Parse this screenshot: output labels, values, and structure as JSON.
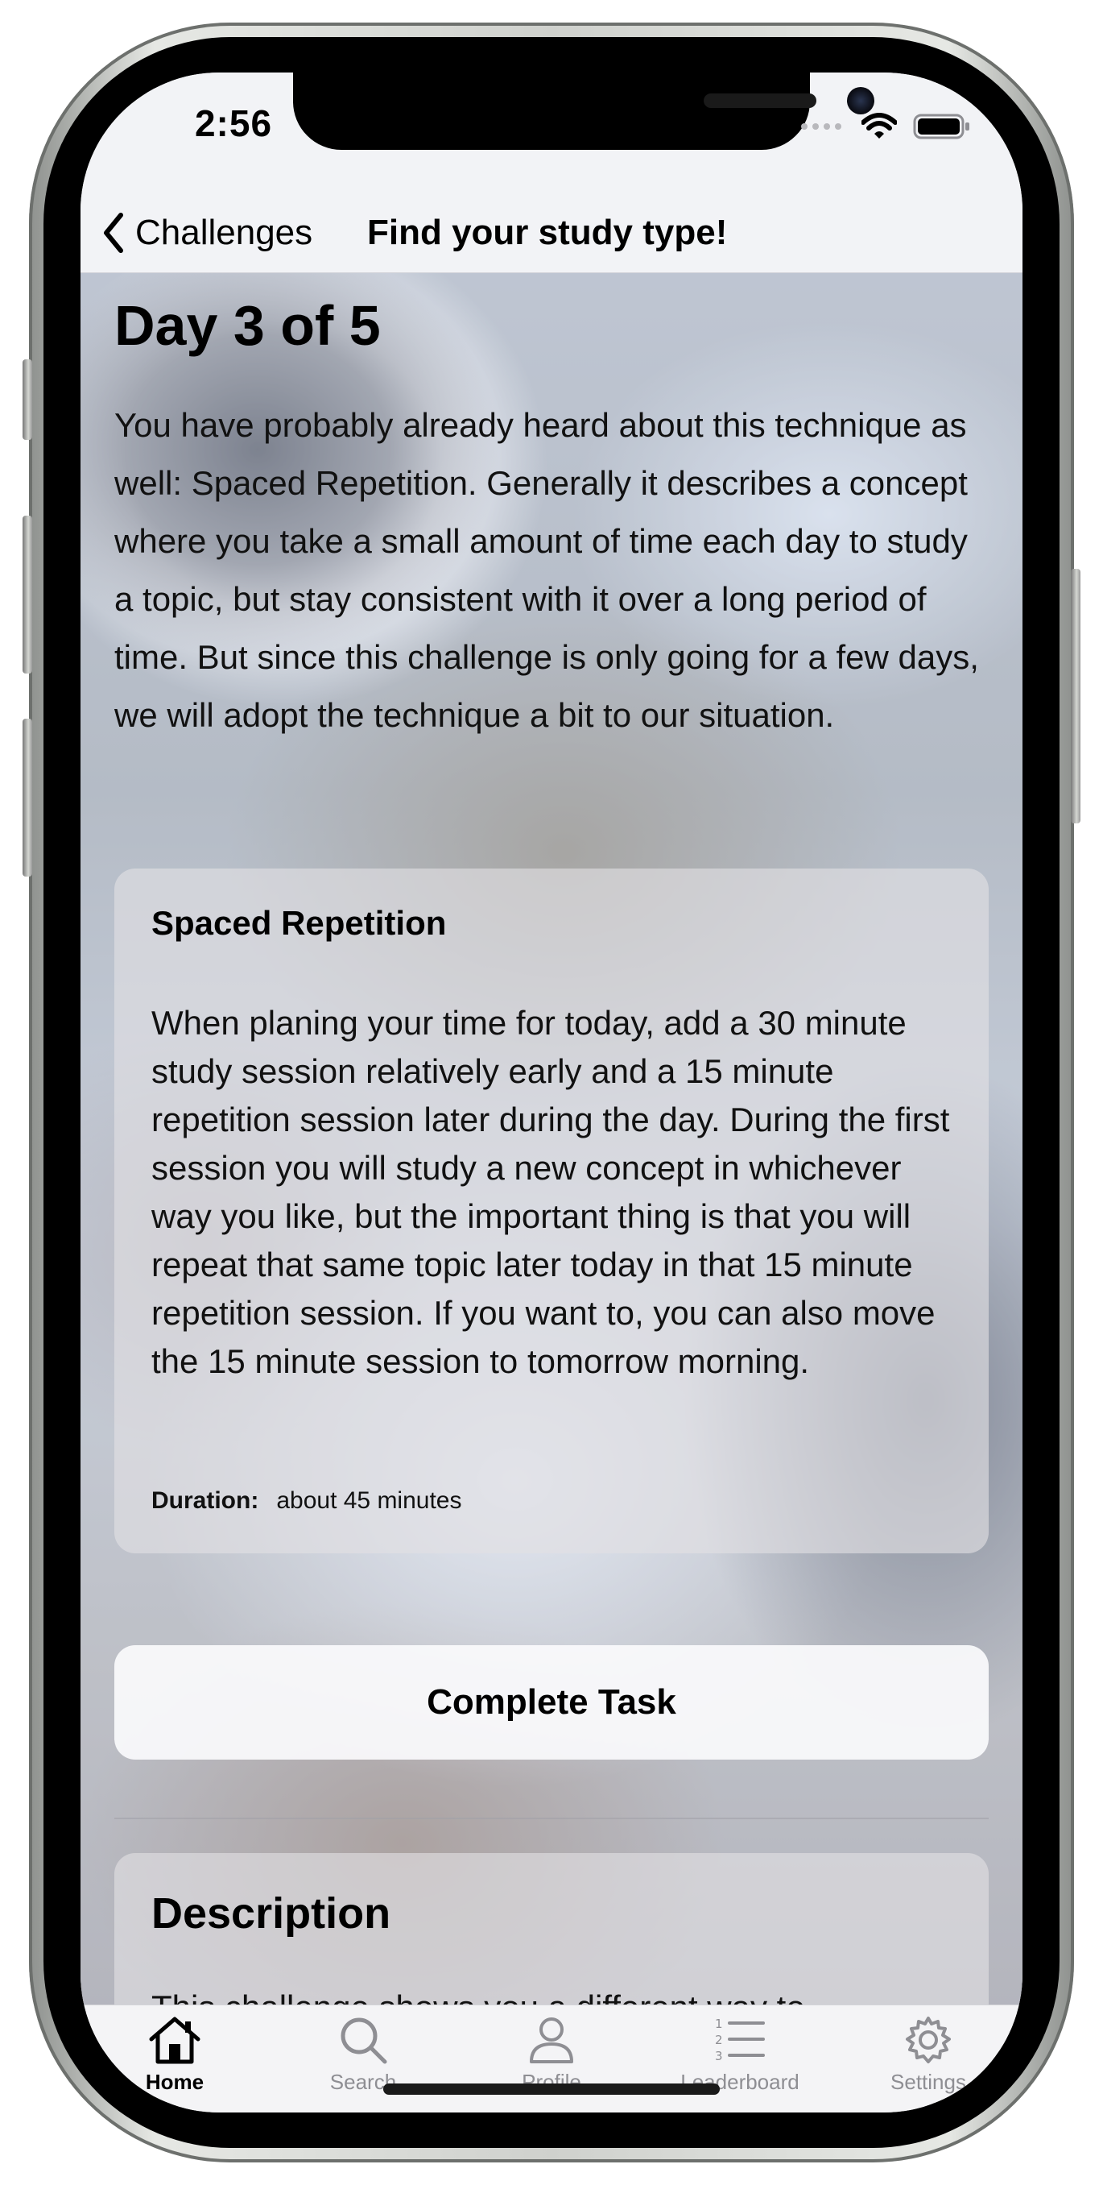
{
  "status_bar": {
    "time": "2:56"
  },
  "nav": {
    "back_label": "Challenges",
    "title": "Find your study type!"
  },
  "content": {
    "day_title": "Day 3 of 5",
    "intro": "You have probably already heard about this technique as well: Spaced Repetition. Generally it describes a concept where you take a small amount of time each day to study a topic, but stay consistent with it over a long period of time. But since this challenge is only going for a few days, we will adopt the technique a bit to our situation.",
    "task": {
      "title": "Spaced Repetition",
      "body": "When planing your time for today, add a 30 minute study session relatively early and a 15 minute repetition session later during the day. During the first session you will study a new concept in whichever way you like, but the important thing is that you will repeat that same topic later today in that 15 minute repetition session. If you want to, you can also move the 15 minute session to tomorrow morning.",
      "duration_label": "Duration:",
      "duration_value": "about 45 minutes"
    },
    "complete_button": "Complete Task",
    "description": {
      "title": "Description",
      "body": "This challenge shows you a different way to"
    }
  },
  "tab_bar": {
    "items": [
      {
        "label": "Home",
        "icon": "house-icon",
        "active": true
      },
      {
        "label": "Search",
        "icon": "magnifier-icon",
        "active": false
      },
      {
        "label": "Profile",
        "icon": "person-icon",
        "active": false
      },
      {
        "label": "Leaderboard",
        "icon": "numbered-list-icon",
        "active": false
      },
      {
        "label": "Settings",
        "icon": "gear-icon",
        "active": false
      }
    ]
  },
  "colors": {
    "active_tab": "#000000",
    "inactive_tab": "#8e8e93",
    "card_background": "#e2e0e4"
  }
}
